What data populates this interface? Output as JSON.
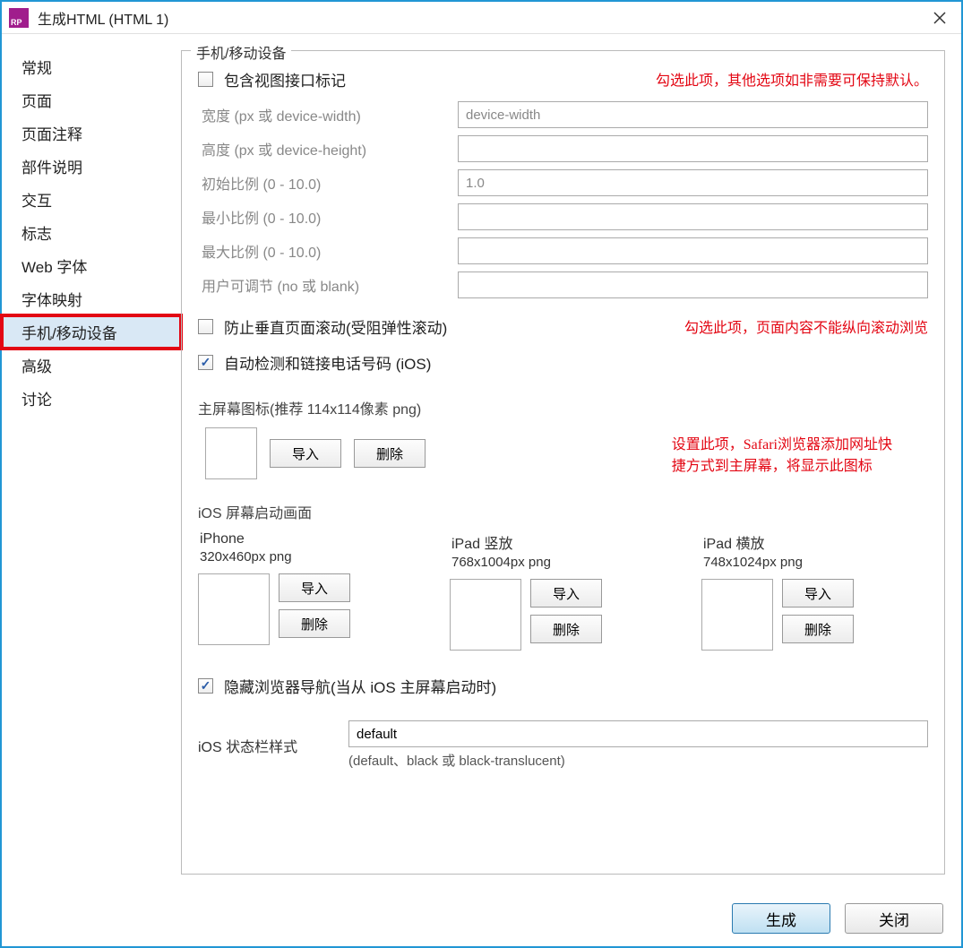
{
  "window": {
    "title": "生成HTML (HTML 1)"
  },
  "sidebar": {
    "items": [
      {
        "label": "常规"
      },
      {
        "label": "页面"
      },
      {
        "label": "页面注释"
      },
      {
        "label": "部件说明"
      },
      {
        "label": "交互"
      },
      {
        "label": "标志"
      },
      {
        "label": "Web 字体"
      },
      {
        "label": "字体映射"
      },
      {
        "label": "手机/移动设备",
        "selected": true
      },
      {
        "label": "高级"
      },
      {
        "label": "讨论"
      }
    ]
  },
  "panel": {
    "legend": "手机/移动设备",
    "viewport_checkbox": "包含视图接口标记",
    "annotation1": "勾选此项，其他选项如非需要可保持默认。",
    "fields": {
      "width_label": "宽度 (px 或 device-width)",
      "width_value": "device-width",
      "height_label": "高度 (px 或 device-height)",
      "height_value": "",
      "initial_label": "初始比例 (0 - 10.0)",
      "initial_value": "1.0",
      "min_label": "最小比例 (0 - 10.0)",
      "min_value": "",
      "max_label": "最大比例 (0 - 10.0)",
      "max_value": "",
      "user_label": "用户可调节 (no 或 blank)",
      "user_value": ""
    },
    "prevent_scroll": "防止垂直页面滚动(受阻弹性滚动)",
    "annotation2": "勾选此项，页面内容不能纵向滚动浏览",
    "auto_detect": "自动检测和链接电话号码 (iOS)",
    "home_icon_title": "主屏幕图标(推荐 114x114像素 png)",
    "import_btn": "导入",
    "delete_btn": "删除",
    "annotation3a": "设置此项，Safari浏览器添加网址快",
    "annotation3b": "捷方式到主屏幕，将显示此图标",
    "splash_title": "iOS 屏幕启动画面",
    "splash": [
      {
        "name": "iPhone",
        "dim": "320x460px png"
      },
      {
        "name": "iPad 竖放",
        "dim": "768x1004px png"
      },
      {
        "name": "iPad 横放",
        "dim": "748x1024px png"
      }
    ],
    "hide_nav": "隐藏浏览器导航(当从 iOS 主屏幕启动时)",
    "status_label": "iOS 状态栏样式",
    "status_value": "default",
    "status_hint": "(default、black 或 black-translucent)"
  },
  "footer": {
    "generate": "生成",
    "close": "关闭"
  }
}
